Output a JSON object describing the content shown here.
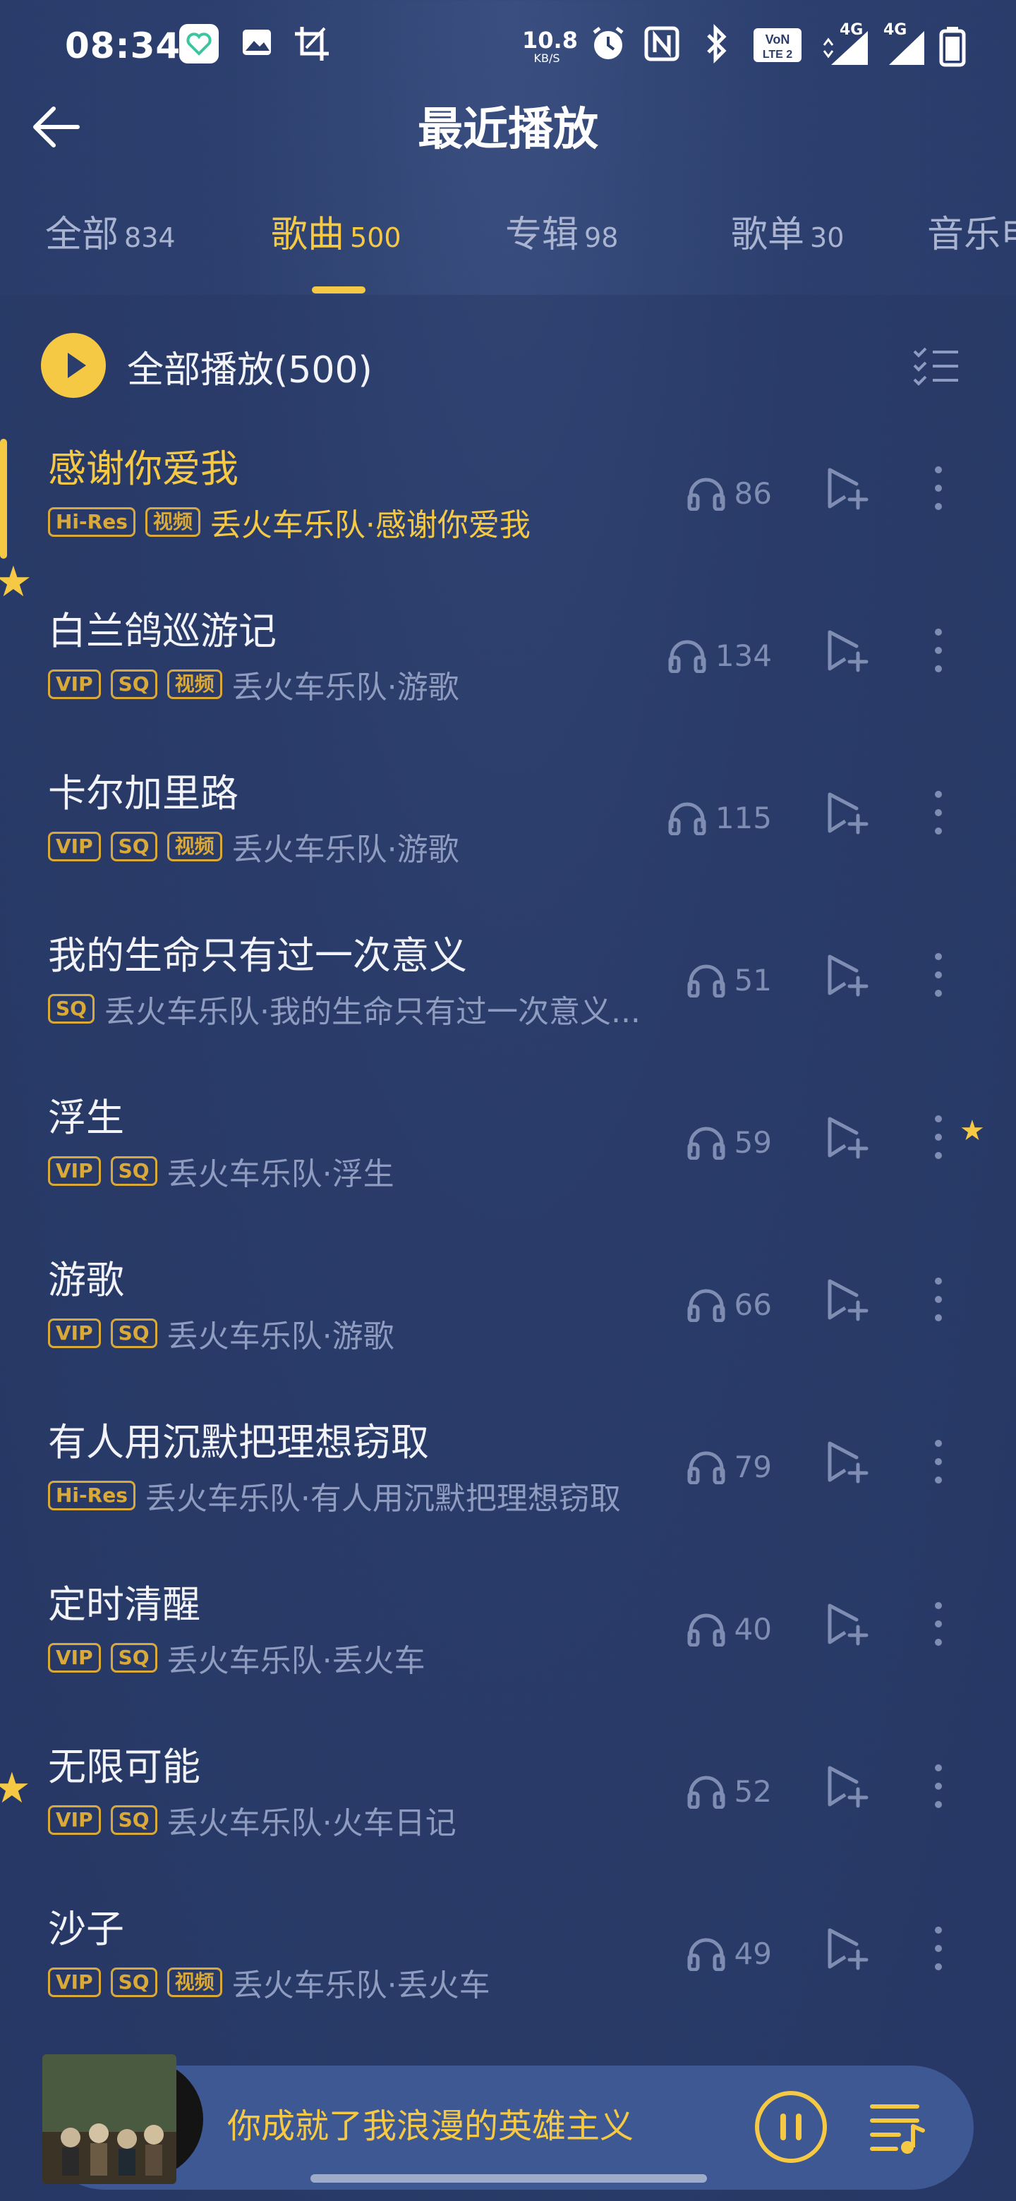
{
  "status_bar": {
    "time": "08:34",
    "net_speed_value": "10.8",
    "net_speed_unit": "KB/S",
    "signal_4g_a": "4G",
    "signal_4g_b": "4G"
  },
  "header": {
    "title": "最近播放"
  },
  "tabs": [
    {
      "label": "全部",
      "count": "834"
    },
    {
      "label": "歌曲",
      "count": "500"
    },
    {
      "label": "专辑",
      "count": "98"
    },
    {
      "label": "歌单",
      "count": "30"
    },
    {
      "label": "音乐电",
      "count": ""
    }
  ],
  "active_tab": "歌曲",
  "play_all": {
    "label": "全部播放(500)"
  },
  "songs": [
    {
      "title": "感谢你爱我",
      "tags": [
        "Hi-Res",
        "视频"
      ],
      "subtitle": "丢火车乐队·感谢你爱我",
      "plays": "86",
      "playing": true
    },
    {
      "title": "白兰鸽巡游记",
      "tags": [
        "VIP",
        "SQ",
        "视频"
      ],
      "subtitle": "丢火车乐队·游歌",
      "plays": "134",
      "playing": false
    },
    {
      "title": "卡尔加里路",
      "tags": [
        "VIP",
        "SQ",
        "视频"
      ],
      "subtitle": "丢火车乐队·游歌",
      "plays": "115",
      "playing": false
    },
    {
      "title": "我的生命只有过一次意义",
      "tags": [
        "SQ"
      ],
      "subtitle": "丢火车乐队·我的生命只有过一次意义...",
      "plays": "51",
      "playing": false
    },
    {
      "title": "浮生",
      "tags": [
        "VIP",
        "SQ"
      ],
      "subtitle": "丢火车乐队·浮生",
      "plays": "59",
      "playing": false
    },
    {
      "title": "游歌",
      "tags": [
        "VIP",
        "SQ"
      ],
      "subtitle": "丢火车乐队·游歌",
      "plays": "66",
      "playing": false
    },
    {
      "title": "有人用沉默把理想窃取",
      "tags": [
        "Hi-Res"
      ],
      "subtitle": "丢火车乐队·有人用沉默把理想窃取",
      "plays": "79",
      "playing": false
    },
    {
      "title": "定时清醒",
      "tags": [
        "VIP",
        "SQ"
      ],
      "subtitle": "丢火车乐队·丢火车",
      "plays": "40",
      "playing": false
    },
    {
      "title": "无限可能",
      "tags": [
        "VIP",
        "SQ"
      ],
      "subtitle": "丢火车乐队·火车日记",
      "plays": "52",
      "playing": false
    },
    {
      "title": "沙子",
      "tags": [
        "VIP",
        "SQ",
        "视频"
      ],
      "subtitle": "丢火车乐队·丢火车",
      "plays": "49",
      "playing": false
    }
  ],
  "mini_player": {
    "now_playing": "你成就了我浪漫的英雄主义"
  },
  "colors": {
    "accent": "#f6c944",
    "background": "#2b3d6b",
    "muted_text": "#8f9cc0"
  },
  "icons": [
    "back-arrow-icon",
    "play-icon",
    "multi-select-icon",
    "headphones-icon",
    "add-to-playlist-icon",
    "more-icon",
    "pause-icon",
    "playlist-icon"
  ]
}
